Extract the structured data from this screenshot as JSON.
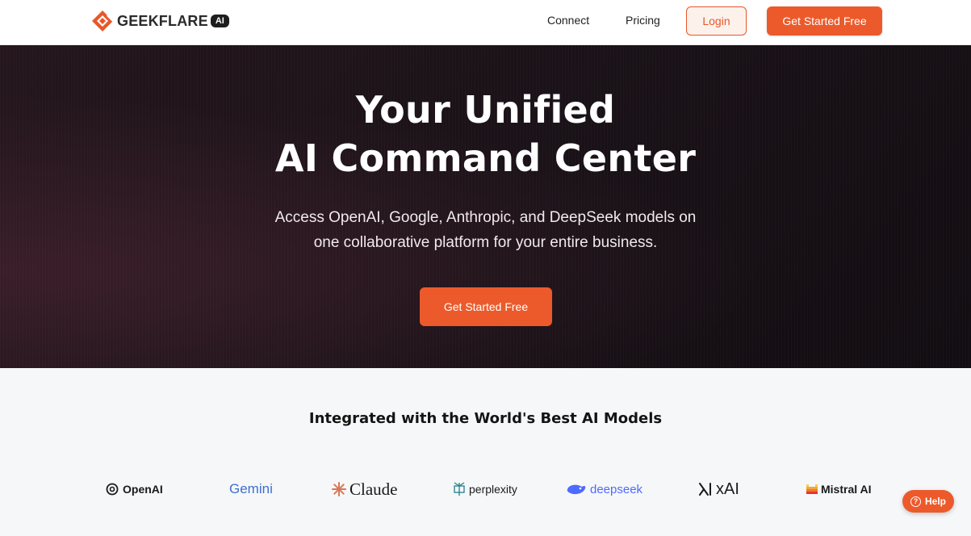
{
  "brand": {
    "name": "GEEKFLARE",
    "badge": "AI",
    "accent": "#ec5a2b"
  },
  "nav": {
    "links": [
      "Connect",
      "Pricing"
    ],
    "login_label": "Login",
    "cta_label": "Get Started Free"
  },
  "hero": {
    "title_line1": "Your Unified",
    "title_line2": "AI Command Center",
    "subtitle_line1": "Access OpenAI, Google, Anthropic, and DeepSeek models on",
    "subtitle_line2": "one collaborative platform for your entire business.",
    "cta_label": "Get Started Free"
  },
  "models": {
    "title": "Integrated with the World's Best AI Models",
    "logos": [
      "OpenAI",
      "Gemini",
      "Claude",
      "perplexity",
      "deepseek",
      "xAI",
      "Mistral AI"
    ]
  },
  "help": {
    "label": "Help"
  }
}
